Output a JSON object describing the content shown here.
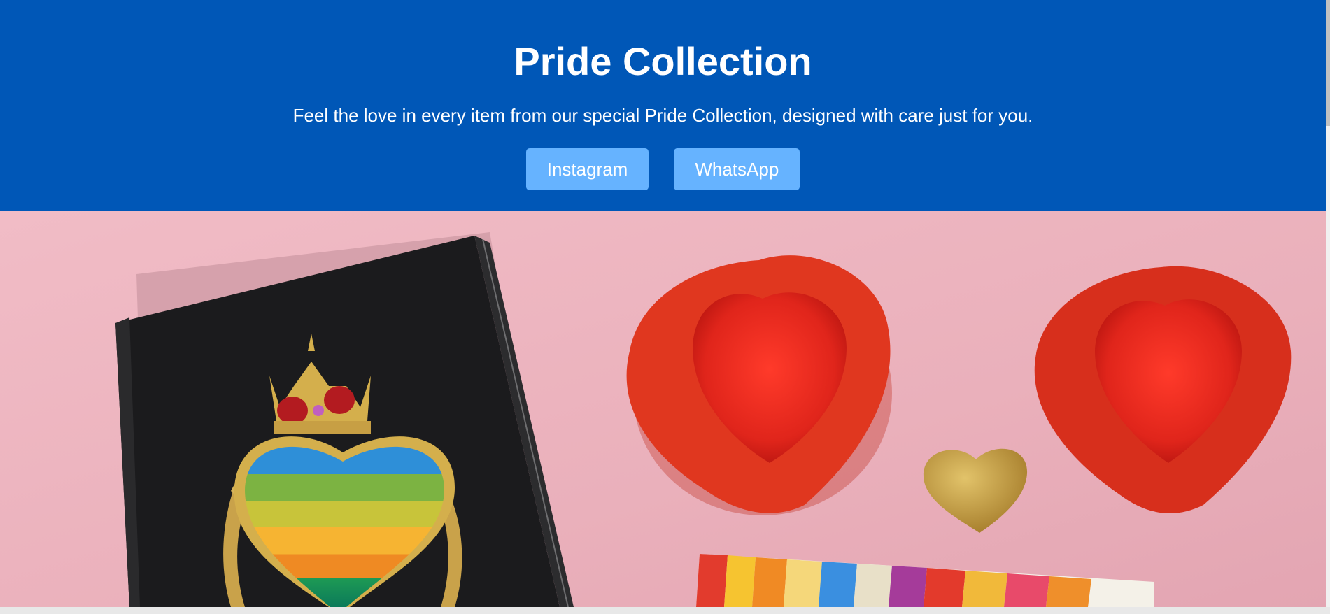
{
  "hero": {
    "title": "Pride Collection",
    "tagline": "Feel the love in every item from our special Pride Collection, designed with care just for you.",
    "buttons": [
      {
        "label": "Instagram"
      },
      {
        "label": "WhatsApp"
      }
    ]
  },
  "colors": {
    "hero_background": "#0057b7",
    "button_background": "#66b3ff",
    "photo_background": "#eeb4bf"
  },
  "photo": {
    "icon": "product-photo-image"
  }
}
